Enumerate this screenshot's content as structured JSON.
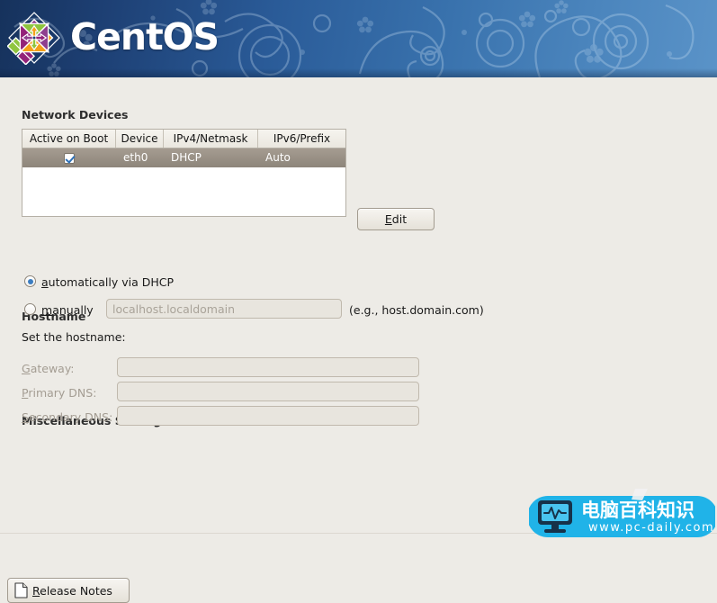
{
  "header": {
    "brand": "CentOS",
    "logo_icon": "centos-logo-icon"
  },
  "network_devices": {
    "section_title": "Network Devices",
    "columns": [
      "Active on Boot",
      "Device",
      "IPv4/Netmask",
      "IPv6/Prefix"
    ],
    "rows": [
      {
        "active_on_boot": true,
        "device": "eth0",
        "ipv4_netmask": "DHCP",
        "ipv6_prefix": "Auto",
        "selected": true
      }
    ],
    "edit_button": {
      "label": "Edit",
      "mnemonic": "E",
      "label_rest": "dit"
    }
  },
  "hostname": {
    "section_title": "Hostname",
    "prompt": "Set the hostname:",
    "options": [
      {
        "id": "auto-dhcp",
        "mnemonic": "a",
        "label_rest": "utomatically via DHCP",
        "selected": true
      },
      {
        "id": "manual",
        "mnemonic": "m",
        "label_rest": "anually",
        "selected": false
      }
    ],
    "manual_input": {
      "value": "",
      "placeholder": "localhost.localdomain",
      "enabled": false
    },
    "example_hint": "(e.g., host.domain.com)"
  },
  "miscellaneous": {
    "section_title": "Miscellaneous Settings",
    "fields": [
      {
        "mnemonic": "G",
        "label_rest": "ateway:",
        "value": "",
        "enabled": false
      },
      {
        "mnemonic": "P",
        "label_rest": "rimary DNS:",
        "value": "",
        "enabled": false
      },
      {
        "mnemonic": "S",
        "label_rest": "econdary DNS:",
        "value": "",
        "enabled": false
      }
    ]
  },
  "footer": {
    "release_notes_button": {
      "icon": "document-page-icon",
      "mnemonic": "R",
      "label_rest": "elease Notes"
    }
  },
  "watermark": {
    "icon": "monitor-pulse-icon",
    "text_cn": "电脑百科知识",
    "url": "www.pc-daily.com",
    "color": "#20b3e8"
  },
  "colors": {
    "banner_dark": "#16325c",
    "banner_light": "#5a93c8",
    "page_background": "#edebe6",
    "row_selected": "#968d82",
    "accent_blue": "#3a7cc0",
    "disabled_text": "#a49d93"
  }
}
